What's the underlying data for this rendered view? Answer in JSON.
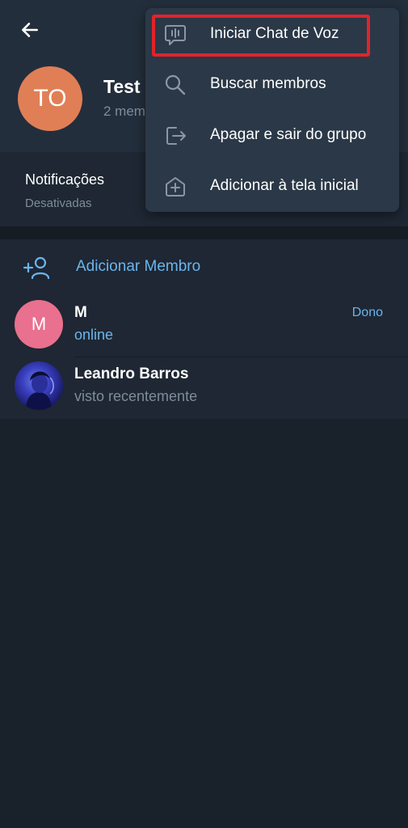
{
  "header": {
    "avatar_initials": "TO",
    "title": "Test",
    "subtitle": "2 mem"
  },
  "notifications": {
    "title": "Notificações",
    "status": "Desativadas"
  },
  "members": {
    "add_label": "Adicionar Membro",
    "list": [
      {
        "avatar_initial": "M",
        "name": "M",
        "status": "online",
        "role": "Dono"
      },
      {
        "avatar_initial": "",
        "name": "Leandro Barros",
        "status": "visto recentemente",
        "role": ""
      }
    ]
  },
  "menu": {
    "items": [
      {
        "label": "Iniciar Chat de Voz",
        "icon": "voice-chat-icon",
        "highlighted": true
      },
      {
        "label": "Buscar membros",
        "icon": "search-icon"
      },
      {
        "label": "Apagar e sair do grupo",
        "icon": "leave-icon"
      },
      {
        "label": "Adicionar à tela inicial",
        "icon": "add-home-icon"
      }
    ]
  },
  "colors": {
    "background": "#19212b",
    "surface": "#1e2733",
    "menu": "#2b3847",
    "accent": "#6cb4ed",
    "highlight": "#e0242a",
    "group_avatar": "#e07f56",
    "member_avatar": "#e9708e"
  }
}
